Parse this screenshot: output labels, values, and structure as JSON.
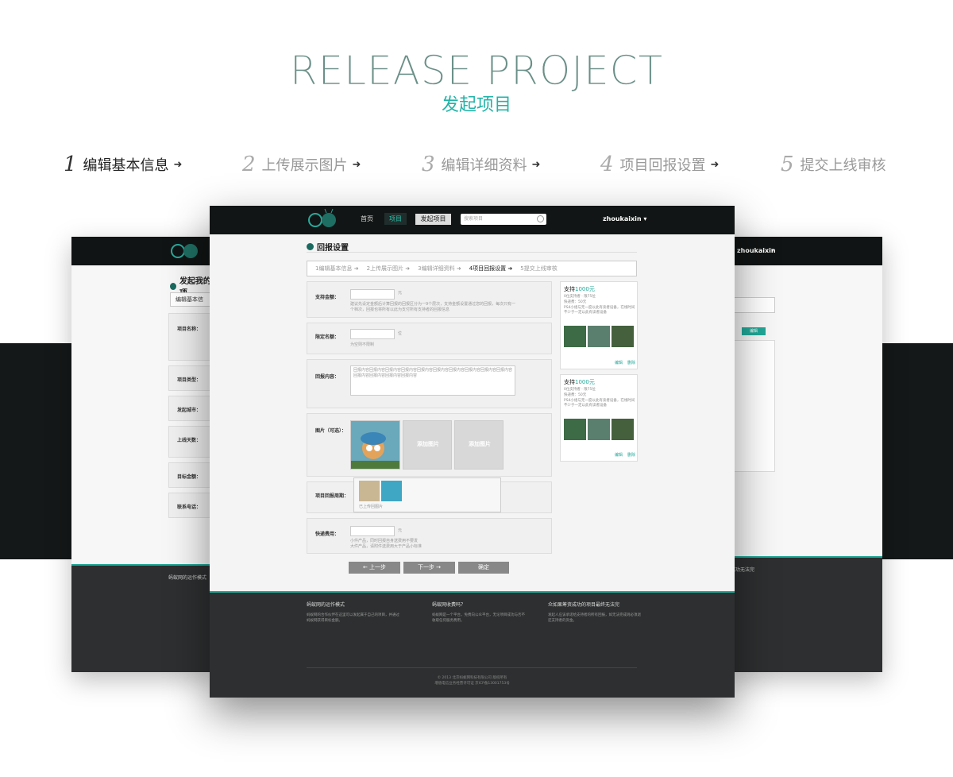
{
  "hero": {
    "title": "RELEASE PROJECT",
    "subtitle": "发起项目"
  },
  "steps": [
    {
      "num": "1",
      "label": "编辑基本信息",
      "active": true
    },
    {
      "num": "2",
      "label": "上传展示图片",
      "active": false
    },
    {
      "num": "3",
      "label": "编辑详细资料",
      "active": false
    },
    {
      "num": "4",
      "label": "项目回报设置",
      "active": false
    },
    {
      "num": "5",
      "label": "提交上线审核",
      "active": false
    }
  ],
  "left_panel": {
    "title": "发起我的项",
    "tab": "编辑基本信",
    "fields": [
      "项目名称：",
      "项目类型：",
      "发起城市：",
      "上线天数：",
      "目标金额：",
      "联系电话："
    ],
    "footer_heading": "蚂蚁网的运作模式"
  },
  "right_panel": {
    "user": "zhoukaixin",
    "edit_button": "编辑",
    "footer_heading": "成功无法完"
  },
  "main": {
    "nav": {
      "home": "首页",
      "projects": "项目",
      "launch": "发起项目",
      "search_placeholder": "搜索项目",
      "user": "zhoukaixin"
    },
    "page_title": "回报设置",
    "substeps": [
      "1编辑基本信息",
      "2上传展示图片",
      "3编辑详细资料",
      "4项目回报设置",
      "5提交上线审核"
    ],
    "form": {
      "support_amount_label": "支持金额：",
      "support_unit": "元",
      "support_hint": "建议先设定金额后计算回报的回报区分为一9个层次，支持金额设置通过您的回报，每次只有一个档次，回报也将所有以此为支付所有支持者的回报信息",
      "quota_label": "限定名额：",
      "quota_unit": "位",
      "quota_hint": "为空则不限制",
      "content_label": "回报内容：",
      "content_text": "回报内容回报内容回报内容回报内容回报内容回报内容回报内容回报内容回报内容回报内容回报内容回报内容回报内容回报内容",
      "images_label": "图片（可选）：",
      "add_image": "添加图片",
      "time_label": "项目回报周期：",
      "time_hint": "已上传回图片",
      "shipping_label": "快递费用：",
      "shipping_unit": "元",
      "shipping_hint": "小件产品，同时回报自身送费用不要发\n大件产品，请附件送费用大于产品小标准"
    },
    "cards": [
      {
        "prefix": "支持",
        "amount": "1000元",
        "meta1": "0位支持者 · 限75位",
        "meta2": "快递费：50元",
        "desc": "PS4小组与无一度以此有读者设备，在线时间不少于一定以此有读者设备",
        "edit": "编辑",
        "delete": "删除"
      },
      {
        "prefix": "支持",
        "amount": "1000元",
        "meta1": "0位支持者 · 限75位",
        "meta2": "快递费：50元",
        "desc": "PS4小组与无一度以此有读者设备，在线时间不少于一定以此有读者设备",
        "edit": "编辑",
        "delete": "删除"
      }
    ],
    "buttons": {
      "prev": "← 上一步",
      "next": "下一步 →",
      "confirm": "确定"
    },
    "footer": {
      "col1_title": "蚂蚁网的运作模式",
      "col1_text": "蚂蚁网的合作伙伴在这里可以发起属于自己的项目，并通过蚂蚁网获得目标金额。",
      "col2_title": "蚂蚁网收费吗？",
      "col2_text": "蚂蚁网是一个平台，免费向公众平台，无论项目成功与否不收取任何服务费用。",
      "col3_title": "众如果筹资成功的项目最终无法完",
      "col3_text": "发起人应该承诺给支持者的所有回报，如无法完成则必须退还支持者的资金。",
      "copyright": "© 2013 北京蚂蚁网科技有限公司  版权所有",
      "icp": "增值电信业务经营许可证  京ICP备13001753号"
    }
  }
}
